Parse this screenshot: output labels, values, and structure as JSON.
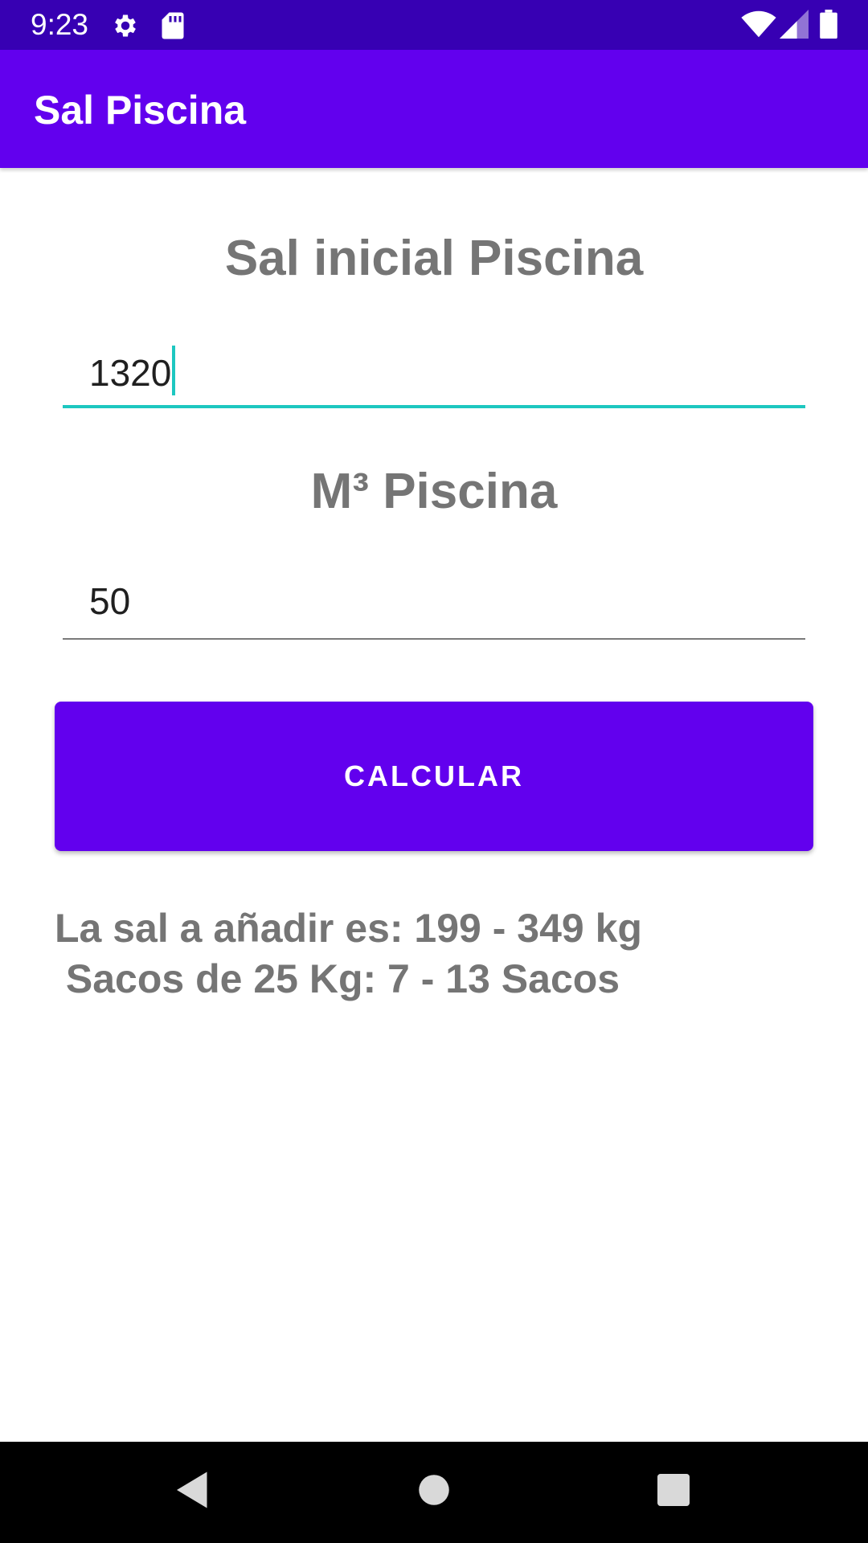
{
  "status_bar": {
    "time": "9:23",
    "icons": [
      "gear-icon",
      "sd-card-icon",
      "wifi-icon",
      "signal-icon",
      "battery-icon"
    ]
  },
  "app_bar": {
    "title": "Sal Piscina",
    "color": "#6200ee"
  },
  "form": {
    "salt_label": "Sal inicial Piscina",
    "salt_value": "1320",
    "volume_label": "M³ Piscina",
    "volume_value": "50",
    "calculate_label": "CALCULAR"
  },
  "result": {
    "line1": "La sal a añadir es: 199 - 349 kg",
    "line2": " Sacos de 25 Kg: 7 - 13 Sacos"
  },
  "nav_bar": {
    "icons": [
      "back-icon",
      "home-icon",
      "recents-icon"
    ]
  },
  "colors": {
    "status_bar": "#3700b3",
    "primary": "#6200ee",
    "focus_accent": "#1dc7c0",
    "label_text": "#757575"
  }
}
